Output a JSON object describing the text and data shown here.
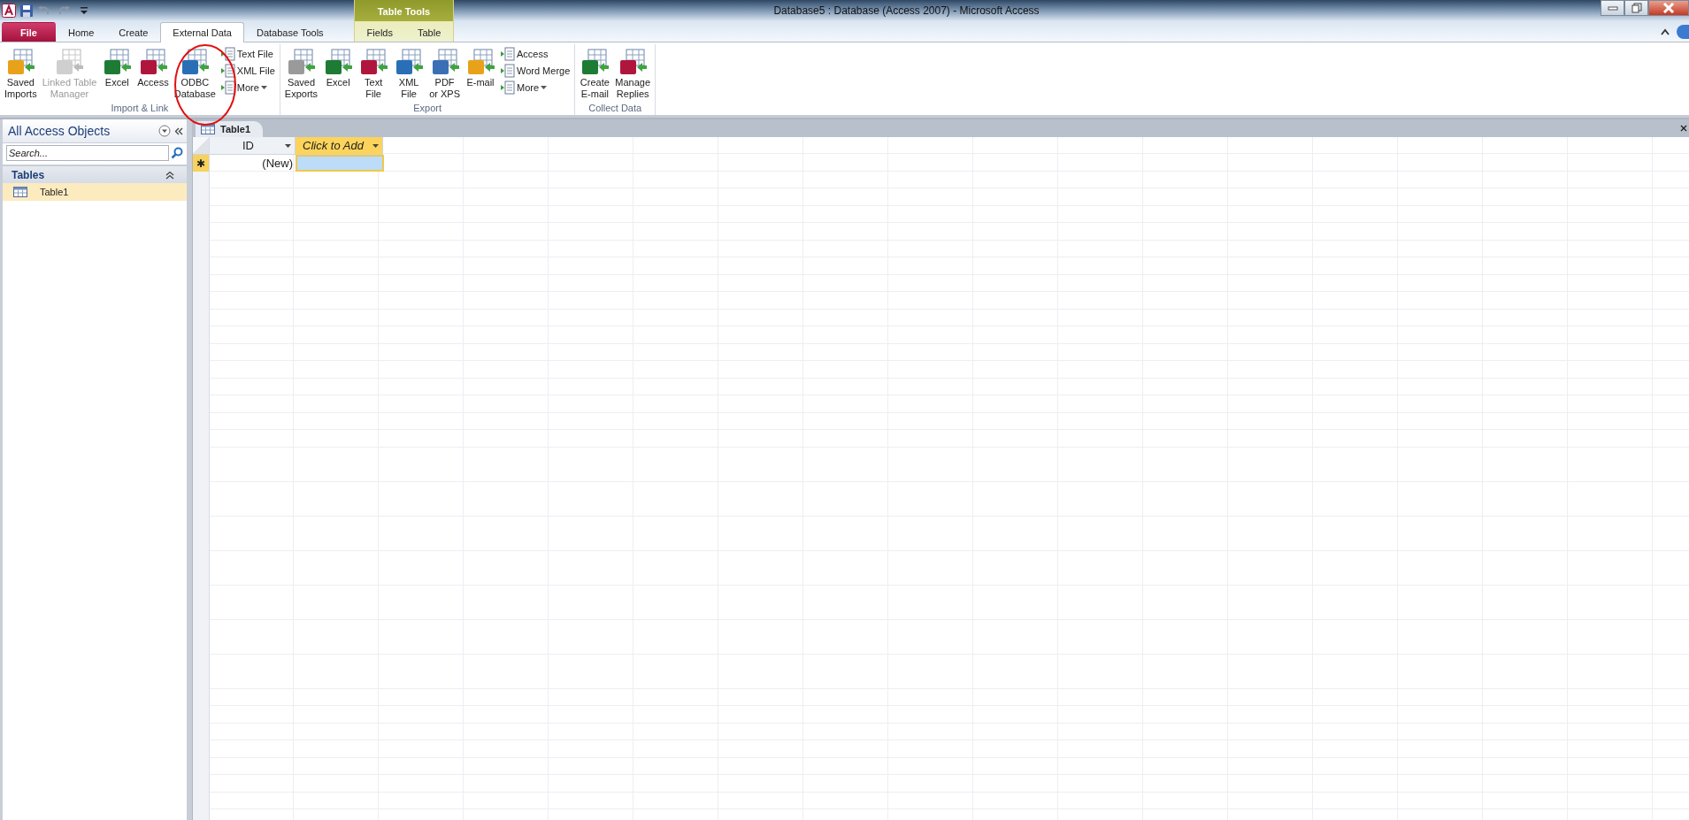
{
  "window": {
    "title": "Database5 : Database (Access 2007)  -  Microsoft Access"
  },
  "contextual_tab_group": {
    "label": "Table Tools"
  },
  "tabs": [
    {
      "label": "File",
      "kind": "file",
      "selected": false
    },
    {
      "label": "Home",
      "kind": "main",
      "selected": false
    },
    {
      "label": "Create",
      "kind": "main",
      "selected": false
    },
    {
      "label": "External Data",
      "kind": "main",
      "selected": true
    },
    {
      "label": "Database Tools",
      "kind": "main",
      "selected": false
    },
    {
      "label": "Fields",
      "kind": "context",
      "selected": false
    },
    {
      "label": "Table",
      "kind": "context",
      "selected": false
    }
  ],
  "ribbon_groups": [
    {
      "label": "Import & Link",
      "large_buttons": [
        {
          "label": "Saved\nImports",
          "disabled": false
        },
        {
          "label": "Linked Table\nManager",
          "disabled": true
        },
        {
          "label": "Excel",
          "disabled": false
        },
        {
          "label": "Access",
          "disabled": false
        },
        {
          "label": "ODBC\nDatabase",
          "disabled": false
        }
      ],
      "small_buttons": [
        {
          "label": "Text File",
          "dropdown": false
        },
        {
          "label": "XML File",
          "dropdown": false
        },
        {
          "label": "More",
          "dropdown": true
        }
      ]
    },
    {
      "label": "Export",
      "large_buttons": [
        {
          "label": "Saved\nExports",
          "disabled": false
        },
        {
          "label": "Excel",
          "disabled": false
        },
        {
          "label": "Text\nFile",
          "disabled": false
        },
        {
          "label": "XML\nFile",
          "disabled": false
        },
        {
          "label": "PDF\nor XPS",
          "disabled": false
        },
        {
          "label": "E-mail",
          "disabled": false
        }
      ],
      "small_buttons": [
        {
          "label": "Access",
          "dropdown": false
        },
        {
          "label": "Word Merge",
          "dropdown": false
        },
        {
          "label": "More",
          "dropdown": true
        }
      ]
    },
    {
      "label": "Collect Data",
      "large_buttons": [
        {
          "label": "Create\nE-mail",
          "disabled": false
        },
        {
          "label": "Manage\nReplies",
          "disabled": false
        }
      ]
    }
  ],
  "navigation_pane": {
    "title": "All Access Objects",
    "search": {
      "placeholder": "Search..."
    },
    "groups": [
      {
        "label": "Tables",
        "expanded": true,
        "items": [
          {
            "label": "Table1",
            "selected": true
          }
        ]
      }
    ]
  },
  "document_tabs": [
    {
      "label": "Table1",
      "selected": true
    }
  ],
  "datasheet": {
    "columns": [
      {
        "label": "ID",
        "kind": "field"
      },
      {
        "label": "Click to Add",
        "kind": "add"
      }
    ],
    "new_row": {
      "selector": "✱",
      "cells": [
        "(New)",
        ""
      ]
    }
  }
}
